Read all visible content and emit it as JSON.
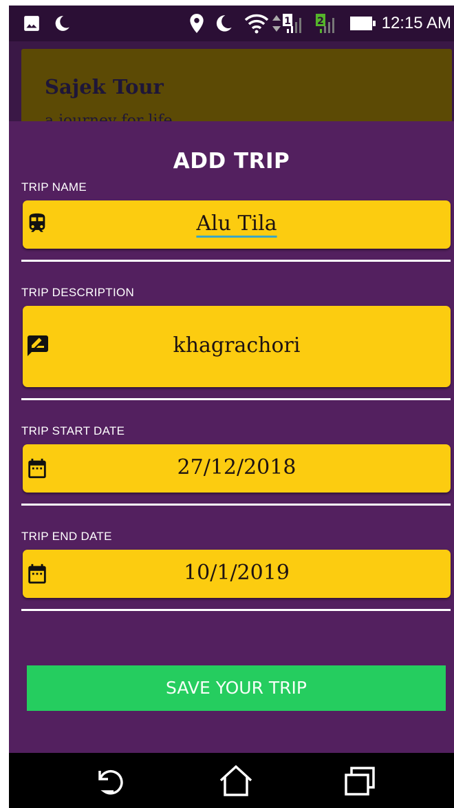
{
  "status_bar": {
    "time": "12:15 AM",
    "sim1": "1",
    "sim2": "2"
  },
  "background_card": {
    "title": "Sajek Tour",
    "subtitle": "a journey for life"
  },
  "dialog": {
    "title": "ADD TRIP",
    "fields": [
      {
        "label": "TRIP NAME",
        "value": "Alu Tila",
        "icon": "train-icon"
      },
      {
        "label": "TRIP DESCRIPTION",
        "value": "khagrachori",
        "icon": "rate-review-icon"
      },
      {
        "label": "TRIP START DATE",
        "value": "27/12/2018",
        "icon": "calendar-icon"
      },
      {
        "label": "TRIP END DATE",
        "value": "10/1/2019",
        "icon": "calendar-icon"
      }
    ],
    "save_label": "SAVE YOUR TRIP"
  },
  "colors": {
    "field_bg": "#fccc10",
    "dialog_bg": "#53205f",
    "save_bg": "#25cd5f",
    "status_bg": "#2b0f35"
  }
}
